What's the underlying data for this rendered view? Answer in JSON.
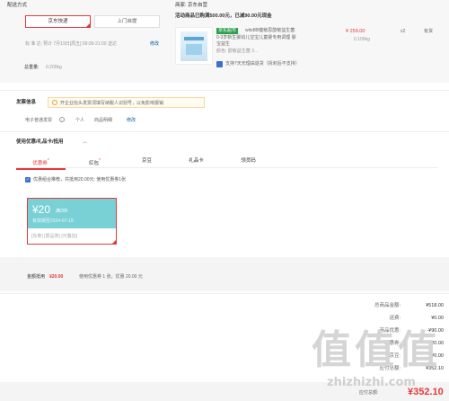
{
  "shipping": {
    "title": "配送方式",
    "options": [
      "京东快递",
      "上门自提"
    ],
    "selected": 0,
    "time_label": "标 准 达:",
    "time_value": "预计 7月19日[周五] 09:00-21:00 送达",
    "time_modify": "修改",
    "weight_label": "总重量:",
    "weight_value": "0.200kg"
  },
  "seller": {
    "name": "商家: 京东自营",
    "promo": "活动商品已购满500.00元，已减90.00元现金"
  },
  "product": {
    "tag": "京东超市",
    "title": "witsBB健敏思醇敏益生菌 0-3岁新生婴幼儿宝宝儿童婴专用调理 婴宝益生",
    "color": "颜色: 醇敏益生菌 3...",
    "price": "¥ 259.00",
    "weight": "0.100kg",
    "qty": "x2",
    "stock": "有货",
    "return_policy": "支持7天无理由退货（拆封后不支持）"
  },
  "invoice": {
    "title": "发票信息",
    "notice": "开企业抬头发票须填写纳税人识别号，以免影响报销",
    "items": [
      "电子普通发票",
      "个人",
      "商品明细"
    ],
    "modify": "修改"
  },
  "discount": {
    "title": "使用优惠/礼品卡/抵用",
    "tabs": [
      "优惠券",
      "红包",
      "京豆",
      "礼品卡",
      "领货码"
    ],
    "active_tab": 0,
    "combo_text": "优惠组合推荐，共抵用20.00元: 使用优惠券1张",
    "coupon": {
      "amount": "¥20",
      "cond": "满200",
      "expiry": "有效期至2024-07-19",
      "tags": "[东券] [限品类] [可叠加]"
    },
    "summary_label": "金额抵用",
    "summary_amount": "¥20.00",
    "summary_text": "使用优惠券 1 张，优惠 20.00 元"
  },
  "totals": {
    "rows": [
      {
        "k": "总商品金额:",
        "v": "¥518.00"
      },
      {
        "k": "运费:",
        "v": "¥0.00"
      },
      {
        "k": "商品优惠:",
        "v": "-¥90.00"
      },
      {
        "k": "优惠券:",
        "v": "-¥20.00"
      },
      {
        "k": "京豆:",
        "v": "-¥0.00"
      },
      {
        "k": "应付总额:",
        "v": "¥352.10"
      }
    ],
    "pay_label": "应付总额:",
    "pay_amount": "¥352.10"
  },
  "watermark": {
    "glyphs": "值值值",
    "site": "zhizhizhi.com"
  }
}
